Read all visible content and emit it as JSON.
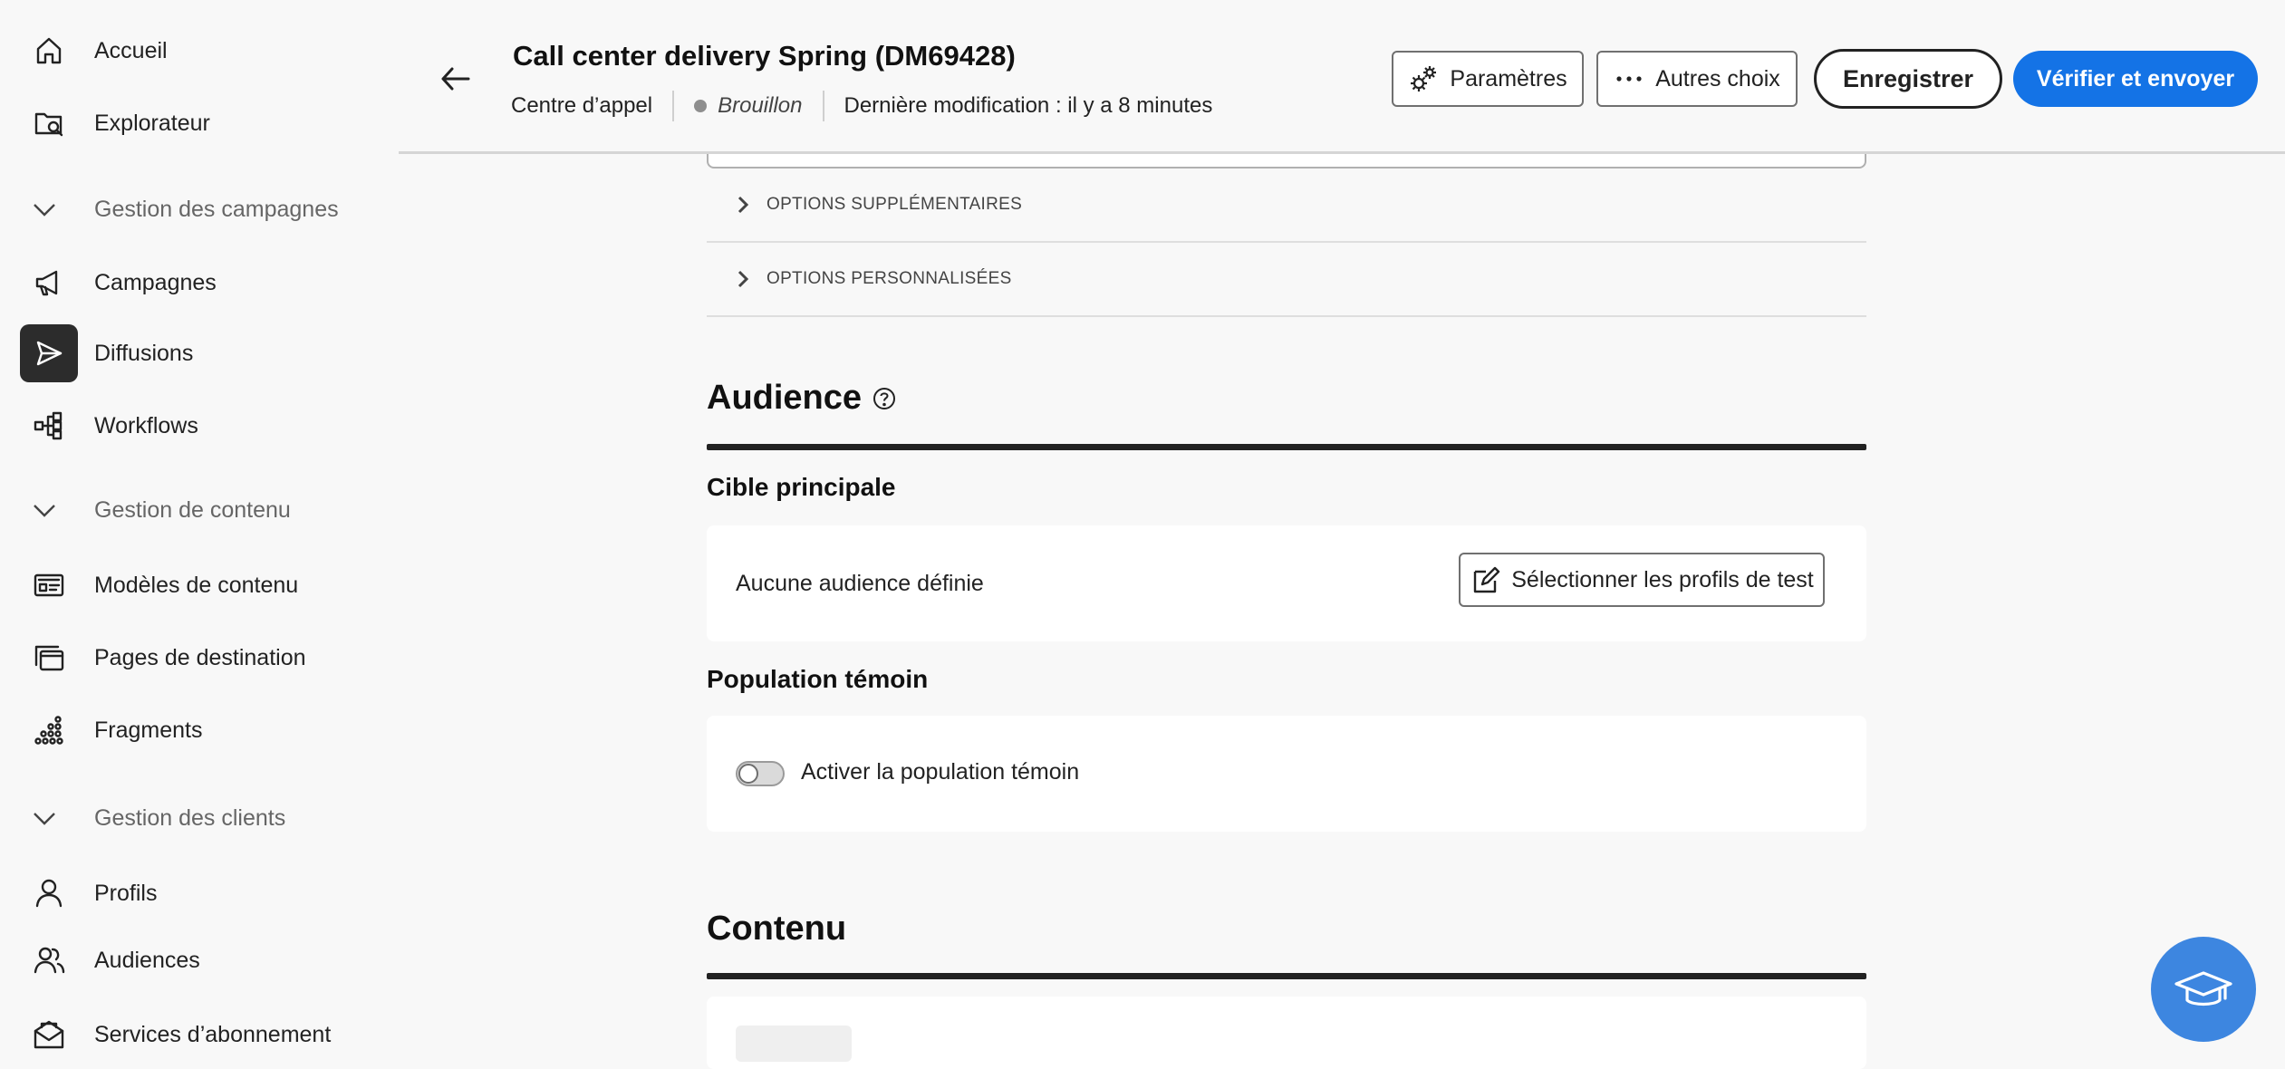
{
  "sidebar": {
    "home": "Accueil",
    "explorer": "Explorateur",
    "campaign_section": "Gestion des campagnes",
    "campaigns": "Campagnes",
    "deliveries": "Diffusions",
    "workflows": "Workflows",
    "content_section": "Gestion de contenu",
    "content_templates": "Modèles de contenu",
    "landing_pages": "Pages de destination",
    "fragments": "Fragments",
    "customer_section": "Gestion des clients",
    "profiles": "Profils",
    "audiences": "Audiences",
    "subscriptions": "Services d’abonnement"
  },
  "header": {
    "title": "Call center delivery Spring (DM69428)",
    "channel": "Centre d’appel",
    "status": "Brouillon",
    "last_modified": "Dernière modification : il y a 8 minutes",
    "settings_label": "Paramètres",
    "more_label": "Autres choix",
    "save_label": "Enregistrer",
    "send_label": "Vérifier et envoyer"
  },
  "main": {
    "accordion_extra": "OPTIONS SUPPLÉMENTAIRES",
    "accordion_custom": "OPTIONS PERSONNALISÉES",
    "audience_title": "Audience",
    "main_target_title": "Cible principale",
    "no_audience": "Aucune audience définie",
    "select_test_profiles": "Sélectionner les profils de test",
    "control_group_title": "Population témoin",
    "control_group_toggle_label": "Activer la population témoin",
    "control_group_enabled": false,
    "content_title": "Contenu"
  },
  "colors": {
    "accent": "#1473e6",
    "help_fab": "#3d86e0",
    "active_nav": "#2c2c2c"
  }
}
